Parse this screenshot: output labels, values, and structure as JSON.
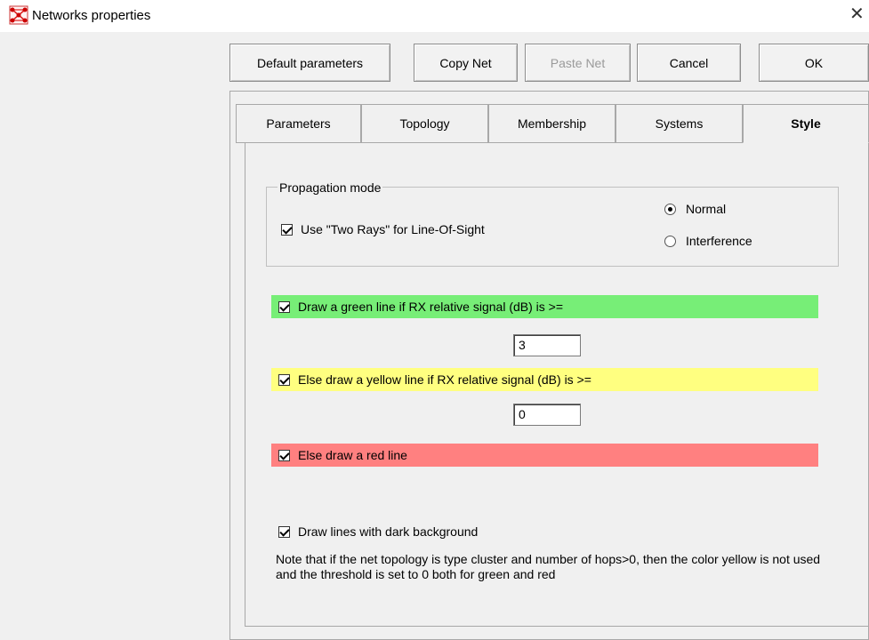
{
  "window": {
    "title": "Networks properties",
    "close_glyph": "✕"
  },
  "toolbar": {
    "default_parameters": "Default parameters",
    "copy_net": "Copy Net",
    "paste_net": "Paste Net",
    "cancel": "Cancel",
    "ok": "OK"
  },
  "tabs": [
    {
      "label": "Parameters",
      "active": false
    },
    {
      "label": "Topology",
      "active": false
    },
    {
      "label": "Membership",
      "active": false
    },
    {
      "label": "Systems",
      "active": false
    },
    {
      "label": "Style",
      "active": true
    }
  ],
  "propagation": {
    "legend": "Propagation mode",
    "two_rays_label": "Use \"Two Rays\" for Line-Of-Sight",
    "two_rays_checked": true,
    "radio_normal": "Normal",
    "radio_interference": "Interference",
    "selected": "Normal"
  },
  "colors": {
    "green": "#77ee77",
    "yellow": "#ffff80",
    "red": "#ff8080"
  },
  "lines": {
    "green_label": "Draw a green line if RX relative signal (dB) is >=",
    "green_checked": true,
    "green_threshold": "3",
    "yellow_label": "Else draw a yellow line if RX relative signal (dB) is >=",
    "yellow_checked": true,
    "yellow_threshold": "0",
    "red_label": "Else draw a red line",
    "red_checked": true
  },
  "dark_background": {
    "label": "Draw lines with dark background",
    "checked": true
  },
  "note": "Note that if the net topology is type cluster and number of hops>0, then the color yellow is not used and the threshold is set to 0 both for green and red"
}
